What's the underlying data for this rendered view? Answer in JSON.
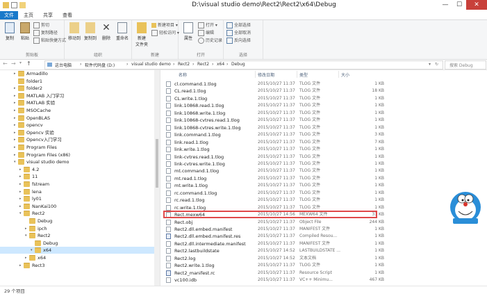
{
  "window": {
    "title": "D:\\visual studio demo\\Rect2\\Rect2\\x64\\Debug",
    "controls": [
      "—",
      "☐",
      "✕"
    ]
  },
  "ribbon_tabs": [
    "文件",
    "主页",
    "共享",
    "查看"
  ],
  "ribbon": {
    "clipboard": {
      "label": "剪贴板",
      "copy": "复制",
      "paste": "粘贴",
      "cut": "剪切",
      "copy_path": "复制路径",
      "paste_shortcut": "粘贴快捷方式"
    },
    "organize": {
      "label": "组织",
      "move_to": "移动到",
      "copy_to": "复制到",
      "delete": "删除",
      "rename": "重命名"
    },
    "new": {
      "label": "新建",
      "new_folder": "新建\n文件夹",
      "new_item": "新建项目 ▾",
      "easy_access": "轻松访问 ▾"
    },
    "open": {
      "label": "打开",
      "properties": "属性",
      "open": "打开 ▾",
      "edit": "编辑",
      "history": "历史记录"
    },
    "select": {
      "label": "选择",
      "select_all": "全部选择",
      "select_none": "全部取消",
      "invert": "反向选择"
    }
  },
  "address": {
    "crumbs": [
      "这台电脑",
      "软件代码盘 (D:)",
      "visual studio demo",
      "Rect2",
      "Rect2",
      "x64",
      "Debug"
    ],
    "search_placeholder": "搜索 Debug"
  },
  "nav_items": [
    {
      "label": "Armadillo",
      "depth": 0,
      "arrow": "▸"
    },
    {
      "label": "folder1",
      "depth": 0,
      "arrow": ""
    },
    {
      "label": "folder2",
      "depth": 0,
      "arrow": "▸"
    },
    {
      "label": "MATLAB 入门学习",
      "depth": 0,
      "arrow": "▸"
    },
    {
      "label": "MATLAB 实验",
      "depth": 0,
      "arrow": "▸"
    },
    {
      "label": "MSOCache",
      "depth": 0,
      "arrow": "▸"
    },
    {
      "label": "OpenBLAS",
      "depth": 0,
      "arrow": "▸"
    },
    {
      "label": "opencv",
      "depth": 0,
      "arrow": "▸"
    },
    {
      "label": "Opencv 实验",
      "depth": 0,
      "arrow": "▸"
    },
    {
      "label": "Opencv入门学习",
      "depth": 0,
      "arrow": "▸"
    },
    {
      "label": "Program Files",
      "depth": 0,
      "arrow": "▸"
    },
    {
      "label": "Program Files (x86)",
      "depth": 0,
      "arrow": "▸"
    },
    {
      "label": "visual studio demo",
      "depth": 0,
      "arrow": "▾"
    },
    {
      "label": "4.2",
      "depth": 1,
      "arrow": "▸"
    },
    {
      "label": "11",
      "depth": 1,
      "arrow": "▸"
    },
    {
      "label": "fstream",
      "depth": 1,
      "arrow": "▸"
    },
    {
      "label": "lena",
      "depth": 1,
      "arrow": "▸"
    },
    {
      "label": "ly01",
      "depth": 1,
      "arrow": "▸"
    },
    {
      "label": "NanKai100",
      "depth": 1,
      "arrow": "▸"
    },
    {
      "label": "Rect2",
      "depth": 1,
      "arrow": "▾"
    },
    {
      "label": "Debug",
      "depth": 2,
      "arrow": ""
    },
    {
      "label": "ipch",
      "depth": 2,
      "arrow": "▸"
    },
    {
      "label": "Rect2",
      "depth": 2,
      "arrow": "▾"
    },
    {
      "label": "Debug",
      "depth": 3,
      "arrow": ""
    },
    {
      "label": "x64",
      "depth": 3,
      "arrow": "▾",
      "selected": true
    },
    {
      "label": "x64",
      "depth": 2,
      "arrow": "▸"
    },
    {
      "label": "Rect3",
      "depth": 1,
      "arrow": "▸"
    }
  ],
  "columns": {
    "name": "名称",
    "date": "修改日期",
    "type": "类型",
    "size": "大小"
  },
  "files": [
    {
      "name": "cl.command.1.tlog",
      "date": "2015/10/27 11:37",
      "type": "TLOG 文件",
      "size": "1 KB",
      "icon": "doc"
    },
    {
      "name": "CL.read.1.tlog",
      "date": "2015/10/27 11:37",
      "type": "TLOG 文件",
      "size": "18 KB",
      "icon": "doc"
    },
    {
      "name": "CL.write.1.tlog",
      "date": "2015/10/27 11:37",
      "type": "TLOG 文件",
      "size": "1 KB",
      "icon": "doc"
    },
    {
      "name": "link.10868.read.1.tlog",
      "date": "2015/10/27 11:37",
      "type": "TLOG 文件",
      "size": "1 KB",
      "icon": "doc"
    },
    {
      "name": "link.10868.write.1.tlog",
      "date": "2015/10/27 11:37",
      "type": "TLOG 文件",
      "size": "1 KB",
      "icon": "doc"
    },
    {
      "name": "link.10868-cvtres.read.1.tlog",
      "date": "2015/10/27 11:37",
      "type": "TLOG 文件",
      "size": "1 KB",
      "icon": "doc"
    },
    {
      "name": "link.10868-cvtres.write.1.tlog",
      "date": "2015/10/27 11:37",
      "type": "TLOG 文件",
      "size": "1 KB",
      "icon": "doc"
    },
    {
      "name": "link.command.1.tlog",
      "date": "2015/10/27 11:37",
      "type": "TLOG 文件",
      "size": "3 KB",
      "icon": "doc"
    },
    {
      "name": "link.read.1.tlog",
      "date": "2015/10/27 11:37",
      "type": "TLOG 文件",
      "size": "7 KB",
      "icon": "doc"
    },
    {
      "name": "link.write.1.tlog",
      "date": "2015/10/27 11:37",
      "type": "TLOG 文件",
      "size": "1 KB",
      "icon": "doc"
    },
    {
      "name": "link-cvtres.read.1.tlog",
      "date": "2015/10/27 11:37",
      "type": "TLOG 文件",
      "size": "1 KB",
      "icon": "doc"
    },
    {
      "name": "link-cvtres.write.1.tlog",
      "date": "2015/10/27 11:37",
      "type": "TLOG 文件",
      "size": "1 KB",
      "icon": "doc"
    },
    {
      "name": "mt.command.1.tlog",
      "date": "2015/10/27 11:37",
      "type": "TLOG 文件",
      "size": "1 KB",
      "icon": "doc"
    },
    {
      "name": "mt.read.1.tlog",
      "date": "2015/10/27 11:37",
      "type": "TLOG 文件",
      "size": "1 KB",
      "icon": "doc"
    },
    {
      "name": "mt.write.1.tlog",
      "date": "2015/10/27 11:37",
      "type": "TLOG 文件",
      "size": "1 KB",
      "icon": "doc"
    },
    {
      "name": "rc.command.1.tlog",
      "date": "2015/10/27 11:37",
      "type": "TLOG 文件",
      "size": "1 KB",
      "icon": "doc"
    },
    {
      "name": "rc.read.1.tlog",
      "date": "2015/10/27 11:37",
      "type": "TLOG 文件",
      "size": "1 KB",
      "icon": "doc"
    },
    {
      "name": "rc.write.1.tlog",
      "date": "2015/10/27 11:37",
      "type": "TLOG 文件",
      "size": "1 KB",
      "icon": "doc"
    },
    {
      "name": "Rect.mexw64",
      "date": "2015/10/27 14:56",
      "type": "MEXW64 文件",
      "size": "33 KB",
      "icon": "doc",
      "highlighted": true
    },
    {
      "name": "Rect.obj",
      "date": "2015/10/27 11:37",
      "type": "Object File",
      "size": "244 KB",
      "icon": "doc"
    },
    {
      "name": "Rect2.dll.embed.manifest",
      "date": "2015/10/27 11:37",
      "type": "MANIFEST 文件",
      "size": "1 KB",
      "icon": "doc"
    },
    {
      "name": "Rect2.dll.embed.manifest.res",
      "date": "2015/10/27 11:37",
      "type": "Compiled Resou...",
      "size": "1 KB",
      "icon": "res"
    },
    {
      "name": "Rect2.dll.intermediate.manifest",
      "date": "2015/10/27 11:37",
      "type": "MANIFEST 文件",
      "size": "1 KB",
      "icon": "doc"
    },
    {
      "name": "Rect2.lastbuildstate",
      "date": "2015/10/27 14:52",
      "type": "LASTBUILDSTATE ...",
      "size": "1 KB",
      "icon": "doc"
    },
    {
      "name": "Rect2.log",
      "date": "2015/10/27 14:52",
      "type": "文本文档",
      "size": "1 KB",
      "icon": "doc"
    },
    {
      "name": "Rect2.write.1.tlog",
      "date": "2015/10/27 11:37",
      "type": "TLOG 文件",
      "size": "1 KB",
      "icon": "doc"
    },
    {
      "name": "Rect2_manifest.rc",
      "date": "2015/10/27 11:37",
      "type": "Resource Script",
      "size": "1 KB",
      "icon": "res"
    },
    {
      "name": "vc100.idb",
      "date": "2015/10/27 11:37",
      "type": "VC++ Minimu...",
      "size": "467 KB",
      "icon": "doc"
    }
  ],
  "status": {
    "item_count": "29 个项目"
  },
  "colors": {
    "accent": "#1979ca",
    "highlight_box": "#e0494a",
    "selection": "#cde8ff"
  }
}
